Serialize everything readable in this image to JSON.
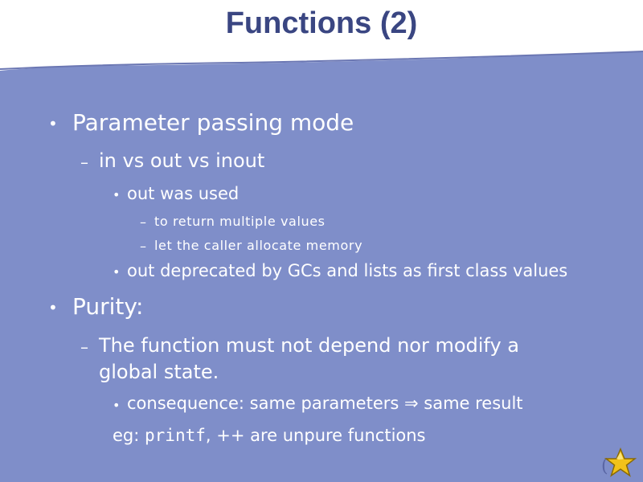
{
  "slide": {
    "title": "Functions (2)",
    "colors": {
      "background": "#7f8ec9",
      "title": "#3a4682",
      "text": "#ffffff",
      "star": "#f2c21a"
    },
    "bullets": {
      "dot": "•",
      "dash": "–",
      "b1": "Parameter passing mode",
      "b1_1": "in vs out vs inout",
      "b1_1_1": "out was used",
      "b1_1_1_1": "to return multiple values",
      "b1_1_1_2": "let the caller allocate memory",
      "b1_1_2": "out deprecated by GCs and lists as first class values",
      "b2": "Purity:",
      "b2_1_line1": "The function must not depend nor modify a",
      "b2_1_line2": "global state.",
      "b2_1_1": "consequence: same parameters ⇒ same result",
      "eg_prefix": "eg: ",
      "eg_code": "printf",
      "eg_sep": ", ",
      "eg_op": "++",
      "eg_suffix": " are unpure functions"
    },
    "corner_mark": "(",
    "star_icon": "star-icon"
  }
}
